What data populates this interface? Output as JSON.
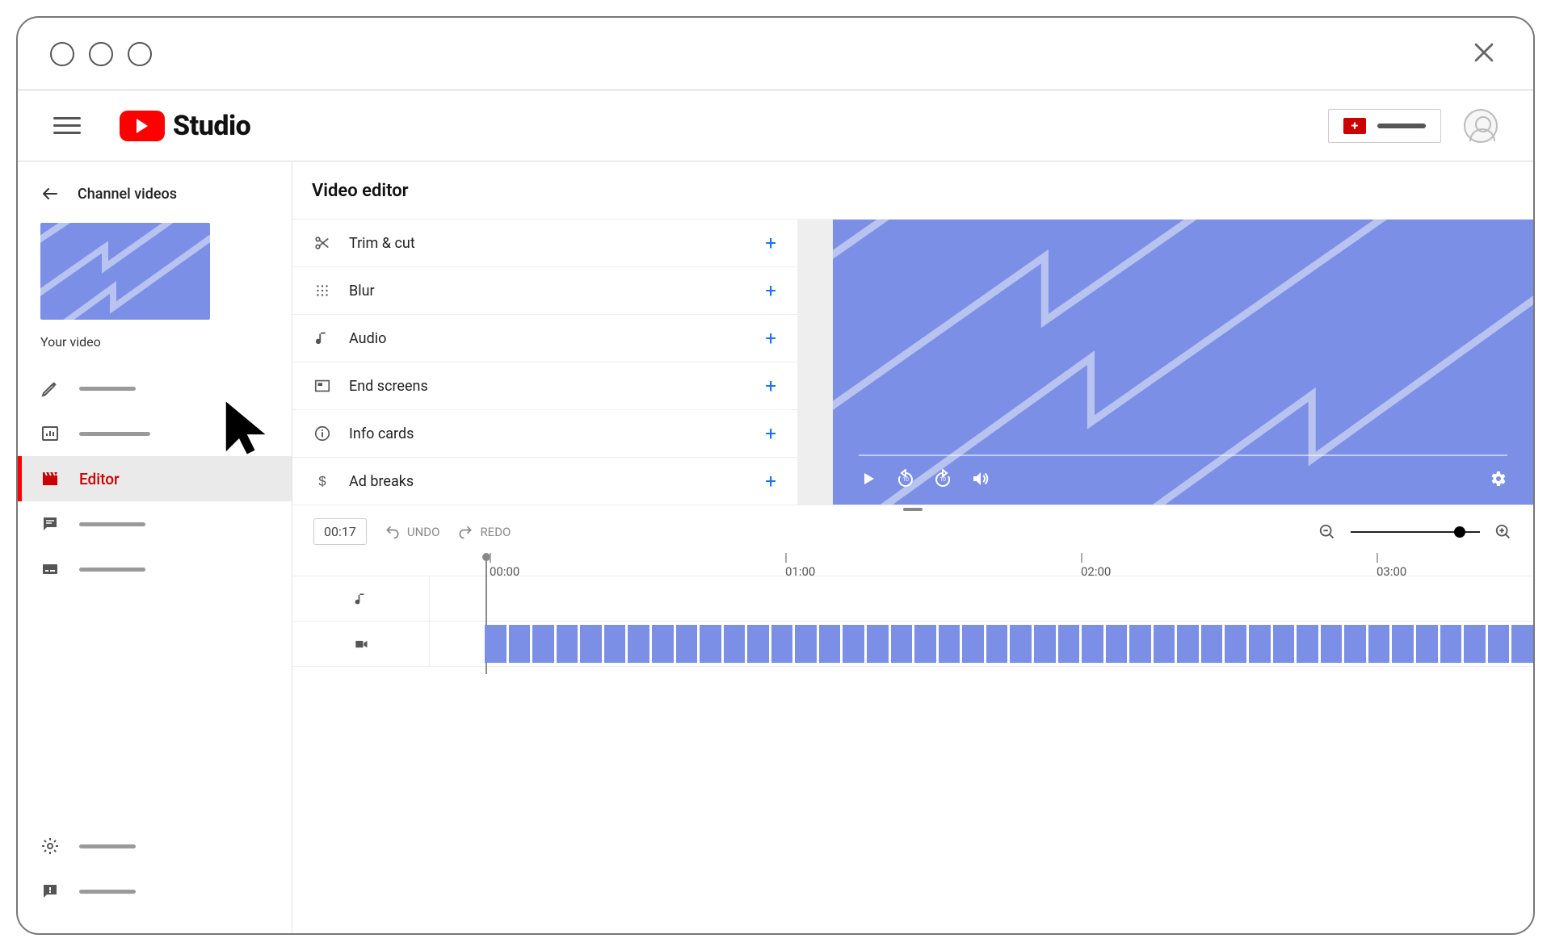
{
  "brand": {
    "name": "Studio"
  },
  "sidebar": {
    "back_label": "Channel videos",
    "section_caption": "Your video",
    "active_label": "Editor"
  },
  "page": {
    "title": "Video editor"
  },
  "tools": {
    "items": [
      {
        "label": "Trim & cut"
      },
      {
        "label": "Blur"
      },
      {
        "label": "Audio"
      },
      {
        "label": "End screens"
      },
      {
        "label": "Info cards"
      },
      {
        "label": "Ad breaks"
      }
    ]
  },
  "timeline": {
    "timestamp": "00:17",
    "undo_label": "UNDO",
    "redo_label": "REDO",
    "ticks": [
      "00:00",
      "01:00",
      "02:00",
      "03:00"
    ]
  }
}
